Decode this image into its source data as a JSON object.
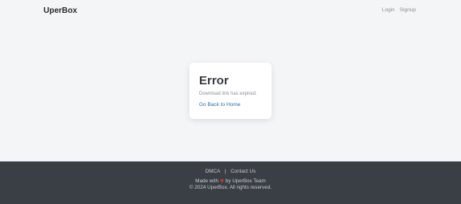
{
  "header": {
    "logo": "UperBox",
    "nav": {
      "login": "Login",
      "signup": "Signup"
    }
  },
  "error_card": {
    "title": "Error",
    "message": "Download link has expired.",
    "link": "Go Back to Home"
  },
  "footer": {
    "dmca": "DMCA",
    "separator": "|",
    "contact": "Contact Us",
    "made_with_prefix": "Made with",
    "heart_icon": "heart-icon",
    "made_with_suffix": "by UperBox Team",
    "copyright": "© 2024 UperBox. All rights reserved."
  },
  "colors": {
    "background": "#f4f5f7",
    "footer_bg": "#3a3f45",
    "link": "#2d6fb7",
    "heart": "#c0392b"
  }
}
